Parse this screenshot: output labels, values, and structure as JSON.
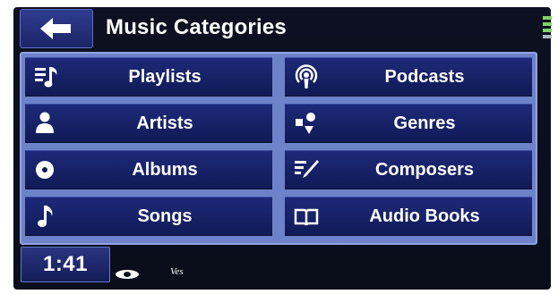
{
  "header": {
    "title": "Music Categories",
    "back_icon": "back-arrow-icon",
    "status_icon": "signal-icon"
  },
  "categories": [
    {
      "label": "Playlists",
      "icon": "playlist-icon"
    },
    {
      "label": "Podcasts",
      "icon": "podcast-icon"
    },
    {
      "label": "Artists",
      "icon": "artist-icon"
    },
    {
      "label": "Genres",
      "icon": "genre-icon"
    },
    {
      "label": "Albums",
      "icon": "album-icon"
    },
    {
      "label": "Composers",
      "icon": "composer-icon"
    },
    {
      "label": "Songs",
      "icon": "song-icon"
    },
    {
      "label": "Audio Books",
      "icon": "audiobook-icon"
    }
  ],
  "footer": {
    "clock": "1:41",
    "label": "Ves"
  },
  "colors": {
    "panel_bg": "#0d1020",
    "button_bg": "#1e2a7a",
    "grid_border": "#8fa2e0",
    "signal_green": "#7fd36a"
  }
}
